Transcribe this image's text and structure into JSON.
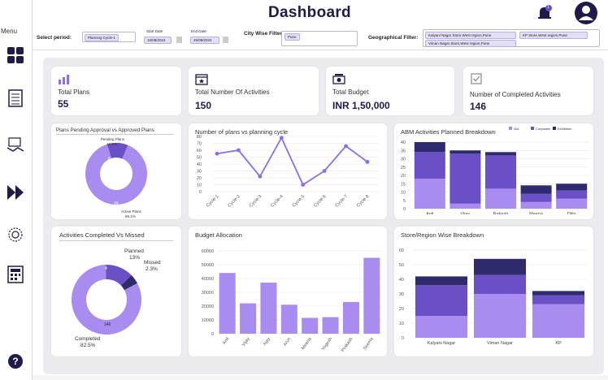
{
  "header": {
    "title": "Dashboard",
    "notification_count": "1"
  },
  "sidebar": {
    "menu_label": "Menu"
  },
  "filters": {
    "period_label": "Select period:",
    "period_value": "Planning Cycle-1",
    "start_label": "Start Date",
    "start_value": "15/08/2024",
    "end_label": "End Date",
    "end_value": "25/08/2024",
    "city_label": "City Wise Filter:",
    "city_value": "Pune",
    "geo_label": "Geographical Filter:",
    "geo_chips": [
      "Kalyani Nagar Store,West region,Pune",
      "KP Store,West region,Pune",
      "Viman Nagar Store,West region,Pune"
    ]
  },
  "kpis": [
    {
      "label": "Total Plans",
      "value": "55",
      "icon": "bar-chart-icon"
    },
    {
      "label": "Total Number Of Activities",
      "value": "150",
      "icon": "calendar-icon"
    },
    {
      "label": "Total Budget",
      "value": "INR 1,50,000",
      "icon": "money-icon"
    },
    {
      "label": "Number of Completed Activities",
      "value": "146",
      "icon": "checkbox-icon"
    }
  ],
  "colors": {
    "dark": "#2e2a6e",
    "mid": "#6a4fc6",
    "light": "#a98cf0",
    "accent": "#8b6ee8",
    "bg": "#ececf0"
  },
  "chart_data": [
    {
      "type": "pie",
      "title": "Plans Pending Approval vs Approved Plans",
      "slices": [
        {
          "label": "Pending Plans",
          "value": 6,
          "pct": "10.9%"
        },
        {
          "label": "Active Plans",
          "value": 49,
          "pct": "89.1%"
        }
      ]
    },
    {
      "type": "line",
      "title": "Number of plans vs planning cycle",
      "categories": [
        "Cycle-1",
        "Cycle-2",
        "Cycle-3",
        "Cycle-4",
        "Cycle-5",
        "Cycle-6",
        "Cycle-7",
        "Cycle-8"
      ],
      "values": [
        55,
        60,
        22,
        78,
        10,
        30,
        66,
        43
      ],
      "ylim": [
        0,
        80
      ],
      "yticks": [
        "0",
        "10",
        "20",
        "30",
        "40",
        "50",
        "60",
        "70",
        "80"
      ]
    },
    {
      "type": "bar",
      "title": "ABM Activities Planned Breakdown",
      "legend": [
        "IAA",
        "Corporate",
        "Exhibition"
      ],
      "categories": [
        "Anil",
        "Vijay",
        "Rakesh",
        "Meena",
        "Dilip"
      ],
      "series": [
        {
          "name": "IAA",
          "values": [
            18,
            3,
            12,
            4,
            6
          ]
        },
        {
          "name": "Corporate",
          "values": [
            16,
            30,
            20,
            5,
            5
          ]
        },
        {
          "name": "Exhibition",
          "values": [
            6,
            2,
            2,
            5,
            4
          ]
        }
      ],
      "ylim": [
        0,
        40
      ],
      "yticks": [
        "0",
        "5",
        "10",
        "15",
        "20",
        "25",
        "30",
        "35",
        "40"
      ]
    },
    {
      "type": "pie",
      "title": "Activities Completed Vs Missed",
      "slices": [
        {
          "label": "Completed",
          "value": 146,
          "pct": "82.5%"
        },
        {
          "label": "Planned",
          "value": 4,
          "pct": "13%"
        },
        {
          "label": "Missed",
          "value": 1,
          "pct": "2.3%"
        }
      ]
    },
    {
      "type": "bar",
      "title": "Budget Allocation",
      "categories": [
        "Anil",
        "Vijay",
        "Ajay",
        "Arun",
        "Meena",
        "Yogesh",
        "Prakash",
        "Seema"
      ],
      "values": [
        44000,
        22000,
        37000,
        21000,
        11500,
        12000,
        23000,
        55000
      ],
      "ylim": [
        0,
        60000
      ],
      "yticks": [
        "0",
        "10000",
        "20000",
        "30000",
        "40000",
        "50000",
        "60000"
      ]
    },
    {
      "type": "bar",
      "title": "Store/Region Wise Breakdown",
      "categories": [
        "Kalyani Nagar",
        "Viman Nagar",
        "KP"
      ],
      "series": [
        {
          "name": "IAA",
          "values": [
            15,
            30,
            23
          ]
        },
        {
          "name": "Corporate",
          "values": [
            21,
            13,
            6
          ]
        },
        {
          "name": "Exhibition",
          "values": [
            6,
            11,
            3
          ]
        }
      ],
      "ylim": [
        0,
        60
      ],
      "yticks": [
        "0",
        "10",
        "20",
        "30",
        "40",
        "50",
        "60"
      ]
    }
  ]
}
